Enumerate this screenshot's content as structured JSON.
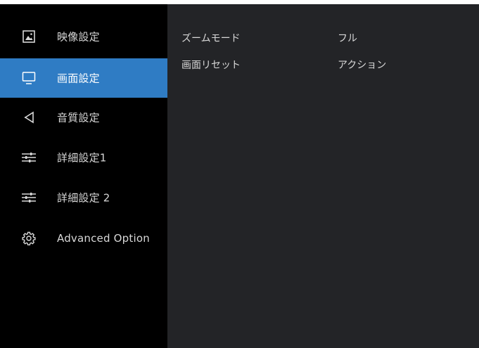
{
  "sidebar": {
    "items": [
      {
        "label": "映像設定",
        "icon": "picture-icon",
        "selected": false
      },
      {
        "label": "画面設定",
        "icon": "monitor-icon",
        "selected": true
      },
      {
        "label": "音質設定",
        "icon": "speaker-icon",
        "selected": false
      },
      {
        "label": "詳細設定1",
        "icon": "sliders-icon",
        "selected": false
      },
      {
        "label": "詳細設定 2",
        "icon": "sliders-icon",
        "selected": false
      },
      {
        "label": "Advanced Option",
        "icon": "gear-icon",
        "selected": false
      }
    ]
  },
  "main": {
    "settings": [
      {
        "name": "ズームモード",
        "value": "フル"
      },
      {
        "name": "画面リセット",
        "value": "アクション"
      }
    ]
  },
  "colors": {
    "sidebar_bg": "#000000",
    "main_bg": "#232427",
    "selected_bg": "#2f7cc4",
    "text": "#d8d8d8"
  }
}
